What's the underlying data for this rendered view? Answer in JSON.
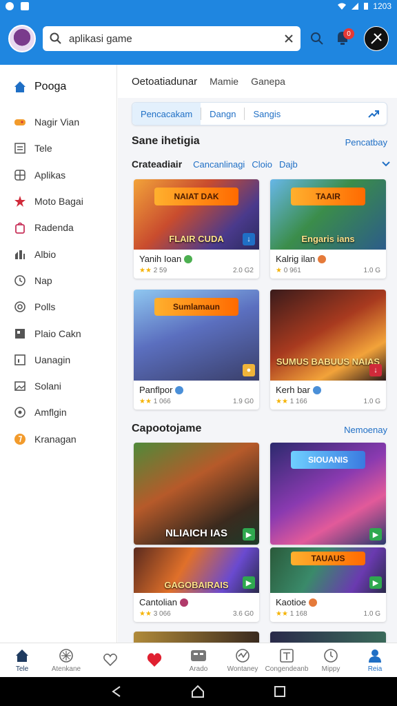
{
  "status_bar": {
    "time": "1203"
  },
  "app_bar": {
    "search_value": "aplikasi game",
    "notification_count": "0"
  },
  "sidebar": {
    "items": [
      {
        "label": "Pooga",
        "icon": "home-icon",
        "color": "#1f6fc5"
      },
      {
        "label": "Nagir Vian",
        "icon": "controller-icon",
        "color": "#f29b2c"
      },
      {
        "label": "Tele",
        "icon": "list-icon",
        "color": "#555555"
      },
      {
        "label": "Aplikas",
        "icon": "grid-icon",
        "color": "#555555"
      },
      {
        "label": "Moto Bagai",
        "icon": "star-icon",
        "color": "#d02a3a"
      },
      {
        "label": "Radenda",
        "icon": "bag-icon",
        "color": "#c8325a"
      },
      {
        "label": "Albio",
        "icon": "chart-icon",
        "color": "#555555"
      },
      {
        "label": "Nap",
        "icon": "clock-icon",
        "color": "#555555"
      },
      {
        "label": "Polls",
        "icon": "circle-icon",
        "color": "#555555"
      },
      {
        "label": "Plaio Cakn",
        "icon": "puzzle-icon",
        "color": "#555555"
      },
      {
        "label": "Uanagin",
        "icon": "square-icon",
        "color": "#555555"
      },
      {
        "label": "Solani",
        "icon": "image-icon",
        "color": "#555555"
      },
      {
        "label": "Amflgin",
        "icon": "settings-icon",
        "color": "#555555"
      },
      {
        "label": "Kranagan",
        "icon": "coin-icon",
        "color": "#f29b2c"
      }
    ]
  },
  "main": {
    "top_tabs": [
      "Oetoatiadunar",
      "Mamie",
      "Ganepa"
    ],
    "chips": [
      "Pencacakam",
      "Dangn",
      "Sangis"
    ],
    "section1": {
      "title": "Sane ihetigia",
      "link": "Pencatbay",
      "filter_title": "Crateadiair",
      "filters": [
        "Cancanlinagi",
        "Cloio",
        "Dajb"
      ]
    },
    "section2": {
      "title": "Capootojame",
      "link": "Nemoenay"
    },
    "cards": [
      {
        "title": "Yanih Ioan",
        "banner": "FLAIR CUDA",
        "logo": "NAIAT DAK",
        "rating": "2 59",
        "size": "2.0 G2"
      },
      {
        "title": "Kalrig ilan",
        "banner": "Engaris ians",
        "logo": "TAAIR",
        "rating": "0 961",
        "size": "1.0 G"
      },
      {
        "title": "Panflpor",
        "banner": "",
        "logo": "Sumlamaun",
        "rating": "1 066",
        "size": "1.9 G0"
      },
      {
        "title": "Kerh bar",
        "banner": "SUMUS BABUUS NAIAS",
        "logo": "",
        "rating": "1 166",
        "size": "1.0 G"
      },
      {
        "title": "",
        "banner": "NLIAICH IAS",
        "logo": "",
        "rating": "",
        "size": ""
      },
      {
        "title": "",
        "banner": "",
        "logo": "SIOUANIS",
        "rating": "",
        "size": ""
      },
      {
        "title": "Cantolian",
        "banner": "GAGOBAIRAIS",
        "logo": "",
        "rating": "3 066",
        "size": "3.6 G0"
      },
      {
        "title": "Kaotioe",
        "banner": "",
        "logo": "TAUAUS",
        "rating": "1 168",
        "size": "1.0 G"
      }
    ]
  },
  "bottom_nav": [
    {
      "label": "Tele",
      "icon": "home-icon"
    },
    {
      "label": "Atenkane",
      "icon": "compass-icon"
    },
    {
      "label": "",
      "icon": "heart-outline-icon"
    },
    {
      "label": "",
      "icon": "heart-icon"
    },
    {
      "label": "Arado",
      "icon": "game-icon"
    },
    {
      "label": "Wontaney",
      "icon": "activity-icon"
    },
    {
      "label": "Congendeanb",
      "icon": "tablet-icon"
    },
    {
      "label": "Mippy",
      "icon": "timer-icon"
    },
    {
      "label": "Reia",
      "icon": "person-icon"
    }
  ]
}
